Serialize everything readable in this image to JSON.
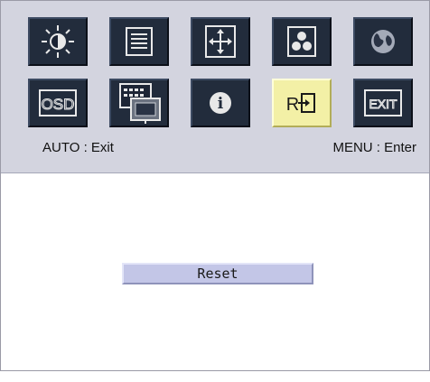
{
  "osd_menu": {
    "row1": [
      {
        "name": "brightness-icon"
      },
      {
        "name": "image-setup-icon"
      },
      {
        "name": "position-icon"
      },
      {
        "name": "color-icon"
      },
      {
        "name": "language-icon"
      }
    ],
    "row2": [
      {
        "name": "osd-setup-icon",
        "label": "OSD"
      },
      {
        "name": "input-source-icon"
      },
      {
        "name": "information-icon",
        "label": "i"
      },
      {
        "name": "reset-icon",
        "label": "R",
        "selected": true
      },
      {
        "name": "exit-icon",
        "label": "EXIT"
      }
    ],
    "selected_item": "reset-icon"
  },
  "hints": {
    "left": "AUTO : Exit",
    "right": "MENU : Enter"
  },
  "submenu": {
    "item_label": "Reset"
  },
  "colors": {
    "panel_top": "#d3d4df",
    "icon_background": "#222c3c",
    "icon_selected": "#f3f0a6",
    "reset_bar": "#c3c6e7"
  }
}
